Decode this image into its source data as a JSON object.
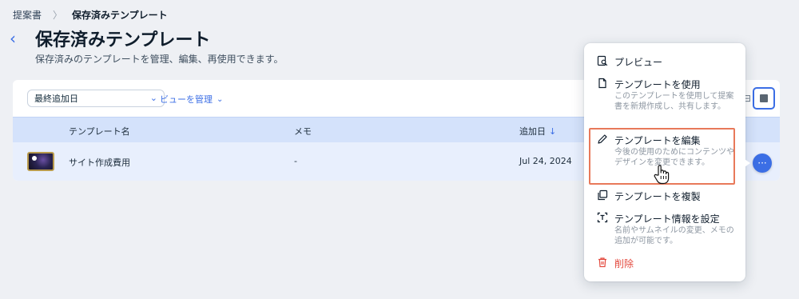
{
  "breadcrumb": {
    "parent": "提案書",
    "current": "保存済みテンプレート"
  },
  "header": {
    "title": "保存済みテンプレート",
    "subtitle": "保存済みのテンプレートを管理、編集、再使用できます。"
  },
  "toolbar": {
    "sort_value": "最終追加日",
    "view_manage": "ビューを管理",
    "view_ctrl_text": "⊟"
  },
  "table": {
    "columns": {
      "name": "テンプレート名",
      "memo": "メモ",
      "added": "追加日",
      "sort_arrow": "↓"
    },
    "rows": [
      {
        "name": "サイト作成費用",
        "memo": "-",
        "added": "Jul 24, 2024"
      }
    ]
  },
  "more_button": {
    "label": "···"
  },
  "menu": {
    "items": [
      {
        "label": "プレビュー",
        "icon": "preview-icon"
      },
      {
        "label": "テンプレートを使用",
        "desc": "このテンプレートを使用して提案書を新規作成し、共有します。",
        "icon": "document-icon"
      },
      {
        "label": "テンプレートを編集",
        "desc": "今後の使用のためにコンテンツやデザインを変更できます。",
        "icon": "pencil-icon"
      },
      {
        "label": "テンプレートを複製",
        "icon": "duplicate-icon"
      },
      {
        "label": "テンプレート情報を設定",
        "desc": "名前やサムネイルの変更、メモの追加が可能です。",
        "icon": "text-box-icon"
      },
      {
        "label": "削除",
        "icon": "trash-icon"
      }
    ]
  },
  "colors": {
    "accent": "#3b6ee5",
    "highlight": "#e8795a",
    "danger": "#e3493e",
    "header_row": "#d4e2fb",
    "selected_row": "#e8effd"
  }
}
